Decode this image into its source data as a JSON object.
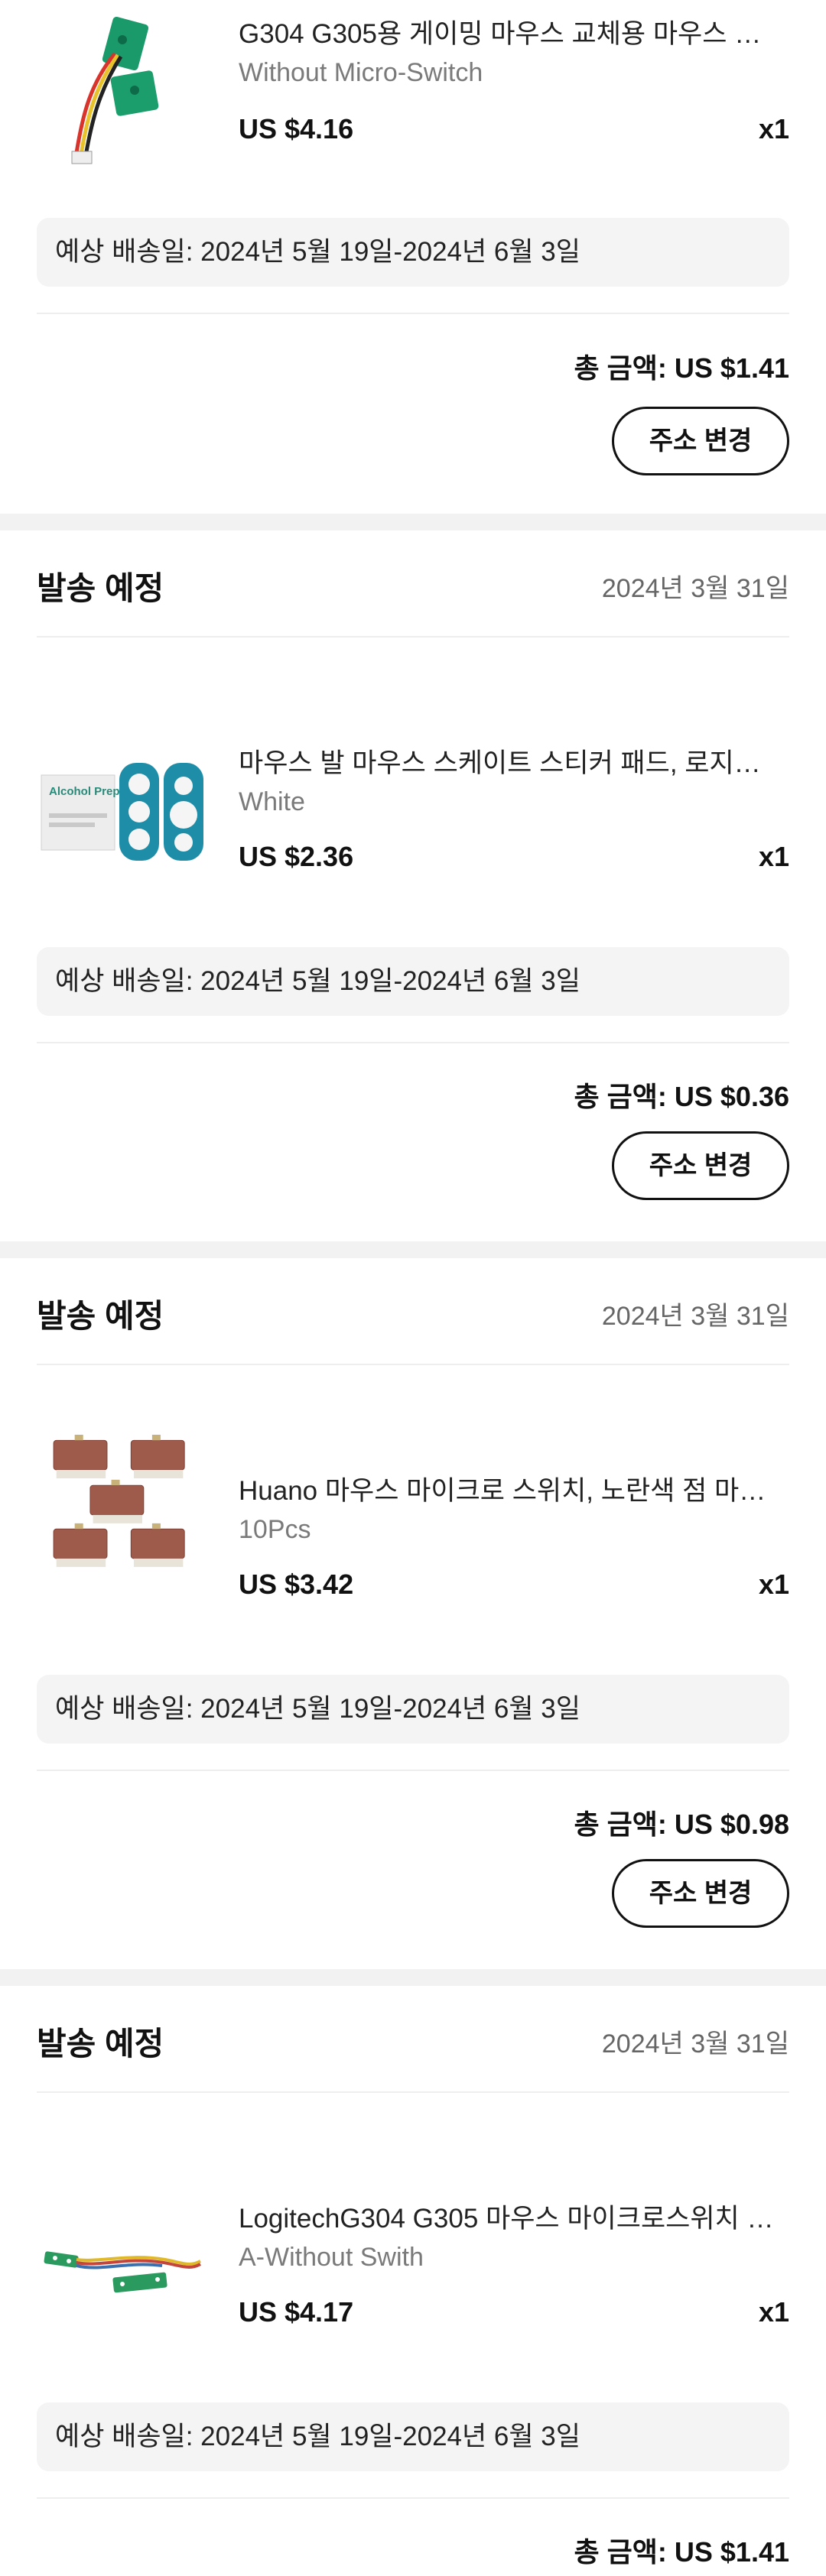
{
  "orders": [
    {
      "product_title": "G304 G305용 게이밍 마우스 교체용 마우스 측…",
      "variant": "Without Micro-Switch",
      "price": "US $4.16",
      "quantity": "x1",
      "delivery": "예상 배송일: 2024년 5월 19일-2024년 6월 3일",
      "total": "총 금액: US $1.41",
      "button": "주소 변경"
    },
    {
      "status": "발송 예정",
      "date": "2024년 3월 31일",
      "product_title": "마우스 발 마우스 스케이트 스티커 패드, 로지텍 …",
      "variant": "White",
      "price": "US $2.36",
      "quantity": "x1",
      "delivery": "예상 배송일: 2024년 5월 19일-2024년 6월 3일",
      "total": "총 금액: US $0.36",
      "button": "주소 변경",
      "image_text": "Alcohol Prep Pad"
    },
    {
      "status": "발송 예정",
      "date": "2024년 3월 31일",
      "product_title": "Huano 마우스 마이크로 스위치, 노란색 점 마이…",
      "variant": "10Pcs",
      "price": "US $3.42",
      "quantity": "x1",
      "delivery": "예상 배송일: 2024년 5월 19일-2024년 6월 3일",
      "total": "총 금액: US $0.98",
      "button": "주소 변경"
    },
    {
      "status": "발송 예정",
      "date": "2024년 3월 31일",
      "product_title": "LogitechG304 G305 마우스 마이크로스위치 …",
      "variant": "A-Without Swith",
      "price": "US $4.17",
      "quantity": "x1",
      "delivery": "예상 배송일: 2024년 5월 19일-2024년 6월 3일",
      "total": "총 금액: US $1.41"
    }
  ]
}
